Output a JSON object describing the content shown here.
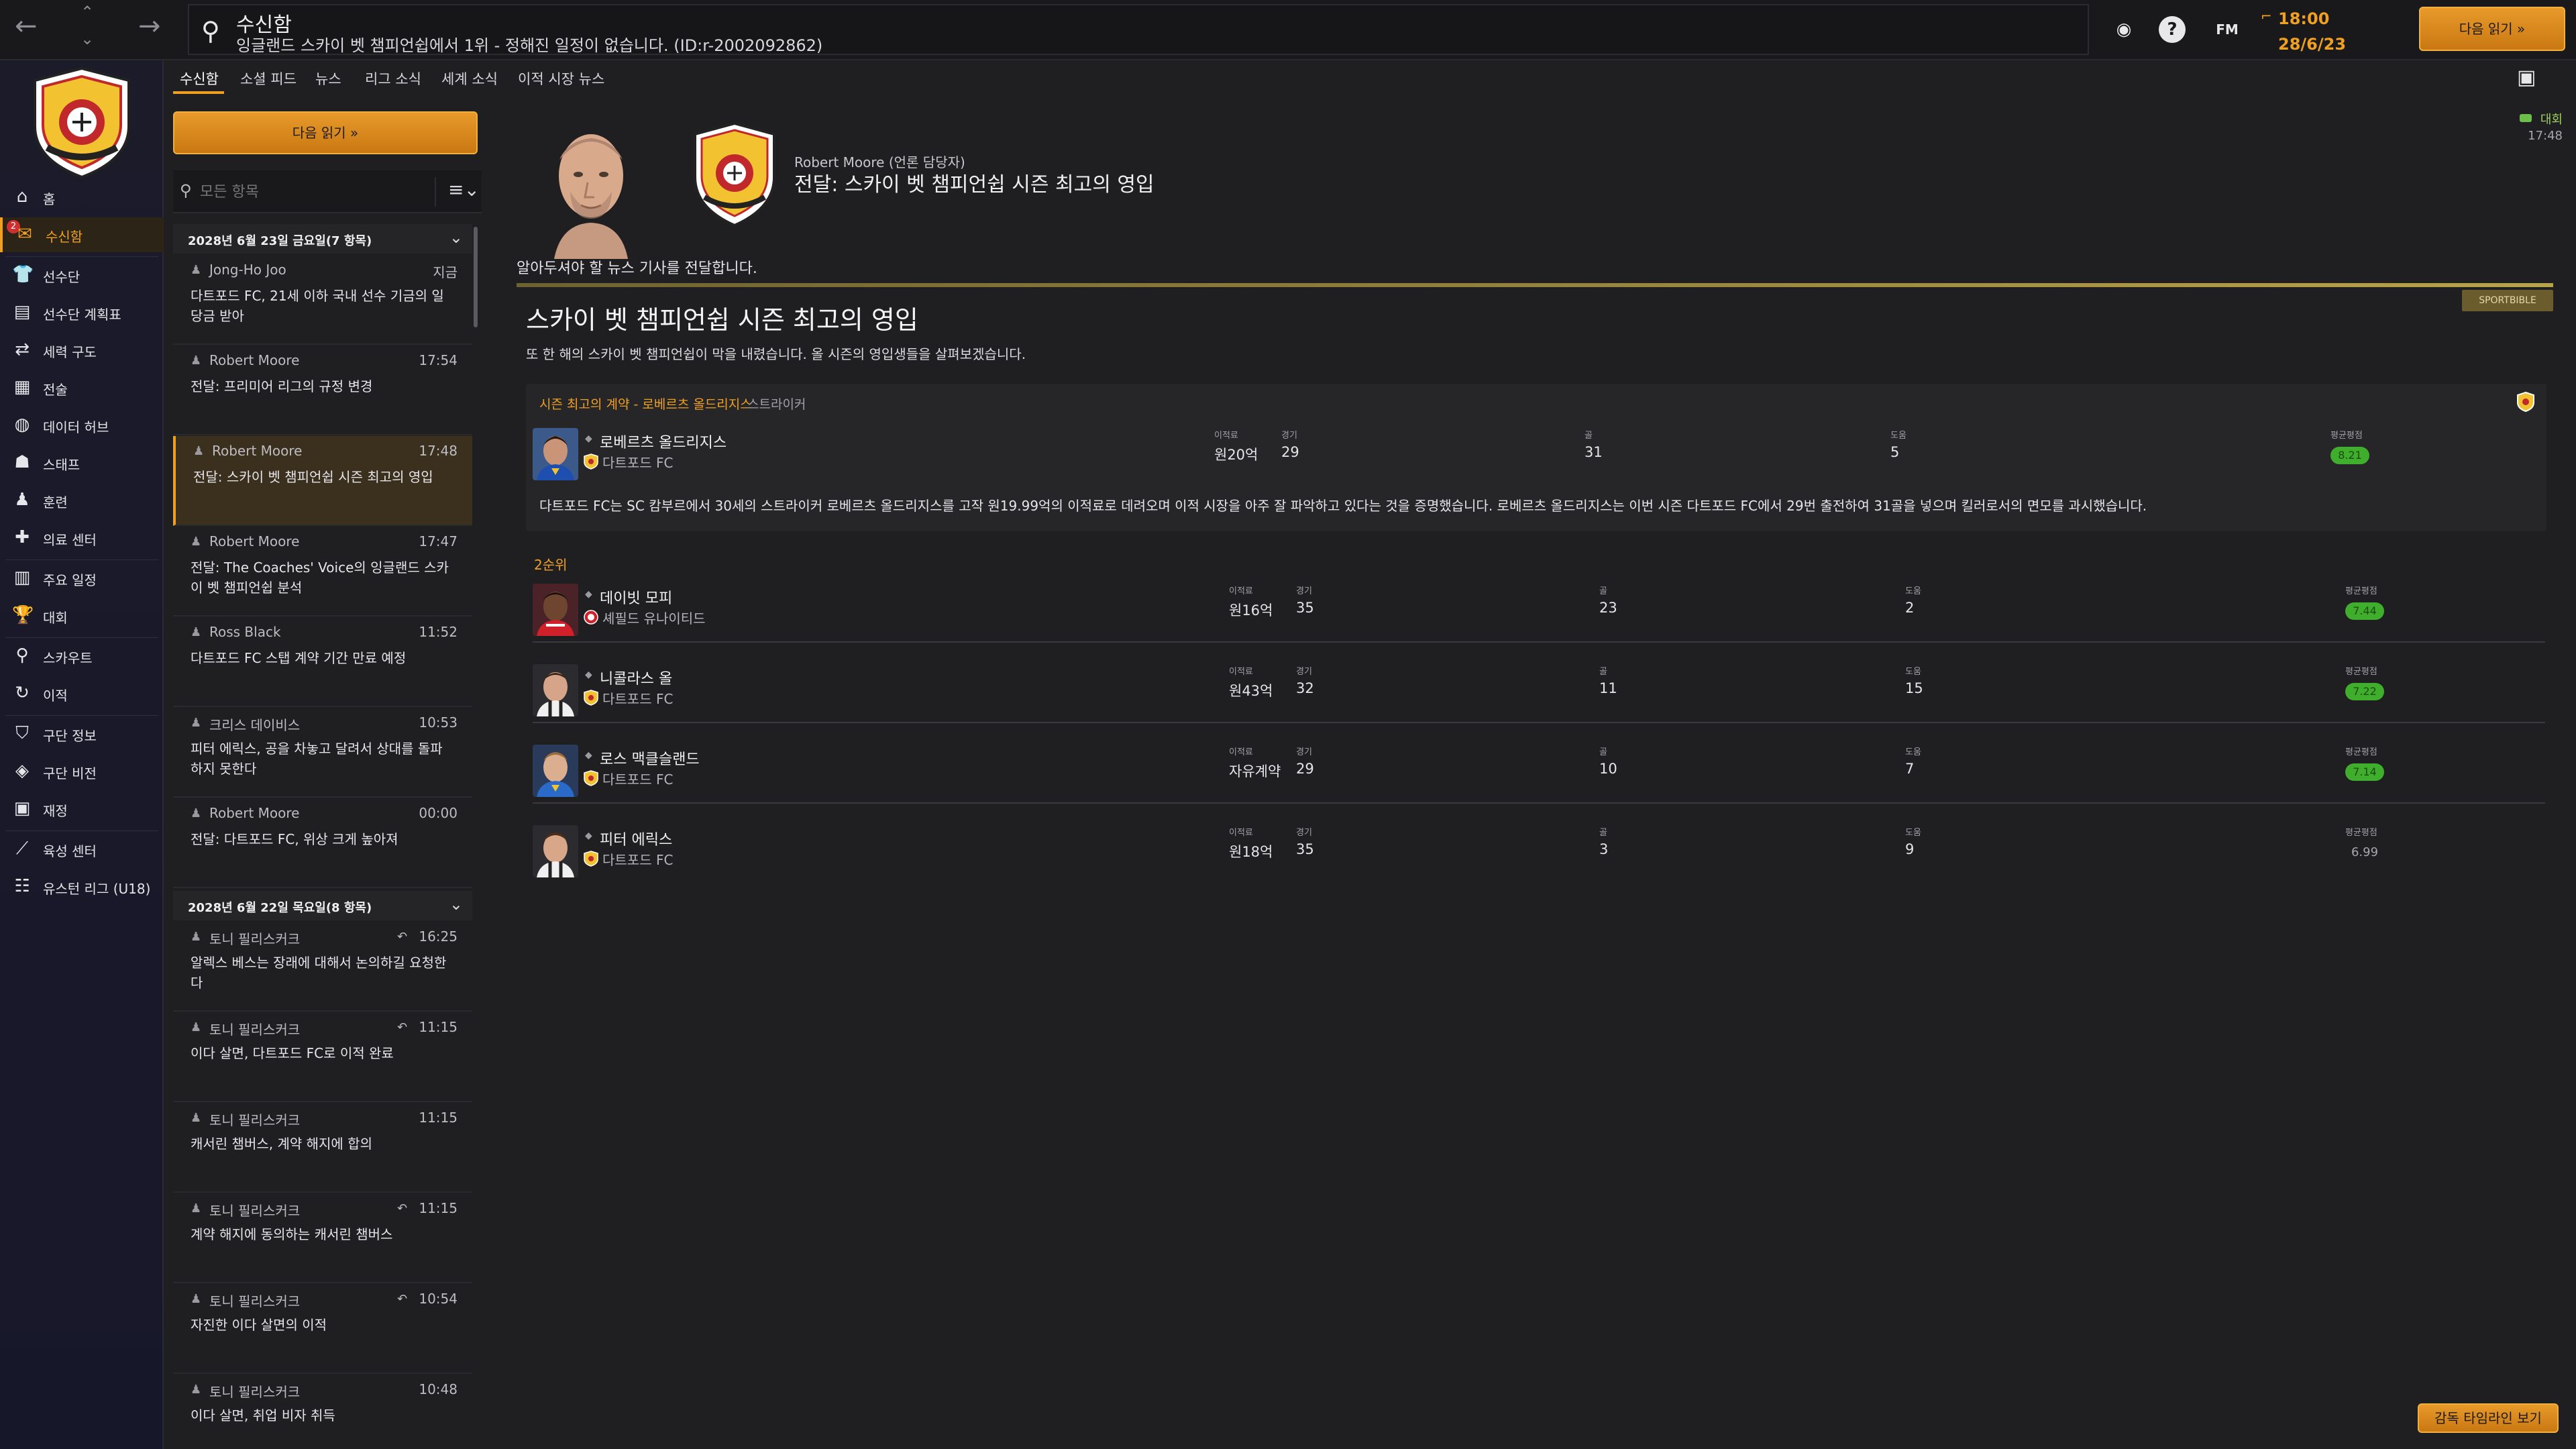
{
  "topbar": {
    "title": "수신함",
    "subtitle": "잉글랜드 스카이 벳 챔피언쉽에서 1위 - 정해진 일정이 없습니다. (ID:r-2002092862)",
    "fm_label": "FM",
    "time": "18:00",
    "date": "28/6/23",
    "continue_label": "다음 읽기 »"
  },
  "sidebar": {
    "items": [
      {
        "label": "홈",
        "icon": "home-icon"
      },
      {
        "label": "수신함",
        "icon": "inbox-icon",
        "badge": "2"
      },
      {
        "label": "선수단",
        "icon": "shirt-icon"
      },
      {
        "label": "선수단 계획표",
        "icon": "clipboard-icon"
      },
      {
        "label": "세력 구도",
        "icon": "dynamics-icon"
      },
      {
        "label": "전술",
        "icon": "tactics-icon"
      },
      {
        "label": "데이터 허브",
        "icon": "data-icon"
      },
      {
        "label": "스태프",
        "icon": "staff-icon"
      },
      {
        "label": "훈련",
        "icon": "training-icon"
      },
      {
        "label": "의료 센터",
        "icon": "medical-icon"
      },
      {
        "label": "주요 일정",
        "icon": "calendar-icon"
      },
      {
        "label": "대회",
        "icon": "trophy-icon"
      },
      {
        "label": "스카우트",
        "icon": "scout-icon"
      },
      {
        "label": "이적",
        "icon": "transfer-icon"
      },
      {
        "label": "구단 정보",
        "icon": "shield-icon"
      },
      {
        "label": "구단 비전",
        "icon": "vision-icon"
      },
      {
        "label": "재정",
        "icon": "finance-icon"
      },
      {
        "label": "육성 센터",
        "icon": "development-icon"
      },
      {
        "label": "유스턴 리그 (U18)",
        "icon": "youth-icon"
      }
    ]
  },
  "tabs": [
    "수신함",
    "소셜 피드",
    "뉴스",
    "리그 소식",
    "세계 소식",
    "이적 시장 뉴스"
  ],
  "inbox": {
    "continue_label": "다음 읽기 »",
    "search_placeholder": "모든 항목",
    "groups": [
      {
        "title": "2028년 6월 23일 금요일(7 항목)",
        "messages": [
          {
            "sender": "Jong-Ho Joo",
            "time": "지금",
            "subject": "다트포드 FC, 21세 이하 국내 선수 기금의 일당금 받아"
          },
          {
            "sender": "Robert Moore",
            "time": "17:54",
            "subject": "전달: 프리미어 리그의 규정 변경"
          },
          {
            "sender": "Robert Moore",
            "time": "17:48",
            "subject": "전달: 스카이 벳 챔피언쉽 시즌 최고의 영입",
            "selected": true
          },
          {
            "sender": "Robert Moore",
            "time": "17:47",
            "subject": "전달: The Coaches' Voice의 잉글랜드 스카이 벳 챔피언쉽 분석"
          },
          {
            "sender": "Ross Black",
            "time": "11:52",
            "subject": "다트포드 FC 스탭 계약 기간 만료 예정"
          },
          {
            "sender": "크리스 데이비스",
            "time": "10:53",
            "subject": "피터 에릭스, 공을 차놓고 달려서 상대를 돌파하지 못한다"
          },
          {
            "sender": "Robert Moore",
            "time": "00:00",
            "subject": "전달: 다트포드 FC, 위상 크게 높아져"
          }
        ]
      },
      {
        "title": "2028년 6월 22일 목요일(8 항목)",
        "messages": [
          {
            "sender": "토니 필리스커크",
            "time": "16:25",
            "subject": "알렉스 베스는 장래에 대해서 논의하길 요청한다",
            "reply": true
          },
          {
            "sender": "토니 필리스커크",
            "time": "11:15",
            "subject": "이다 살면, 다트포드 FC로 이적 완료",
            "reply": true
          },
          {
            "sender": "토니 필리스커크",
            "time": "11:15",
            "subject": "캐서린 챔버스, 계약 해지에 합의"
          },
          {
            "sender": "토니 필리스커크",
            "time": "11:15",
            "subject": "계약 해지에 동의하는 캐서린 챔버스",
            "reply": true
          },
          {
            "sender": "토니 필리스커크",
            "time": "10:54",
            "subject": "자진한 이다 살면의 이적",
            "reply": true
          },
          {
            "sender": "토니 필리스커크",
            "time": "10:48",
            "subject": "이다 살면, 취업 비자 취득"
          }
        ]
      }
    ]
  },
  "message": {
    "from": "Robert Moore (언론 담당자)",
    "subject": "전달: 스카이 벳 챔피언쉽 시즌 최고의 영입",
    "tag": "대회",
    "time": "17:48",
    "intro": "알아두셔야 할 뉴스 기사를 전달합니다.",
    "sponsor": "SPORTBIBLE",
    "article_title": "스카이 벳 챔피언쉽 시즌 최고의 영입",
    "article_lead": "또 한 해의 스카이 벳 챔피언쉽이 막을 내렸습니다. 올 시즌의 영입생들을 살펴보겠습니다.",
    "best_label": "시즌 최고의 계약 - 로베르츠 올드리지스",
    "best_position": "스트라이커",
    "best_desc": "다트포드 FC는 SC 캄부르에서 30세의 스트라이커 로베르츠 올드리지스를 고작 원19.99억의 이적료로 데려오며 이적 시장을 아주 잘 파악하고 있다는 것을 증명했습니다. 로베르츠 올드리지스는 이번 시즌 다트포드 FC에서 29번 출전하여 31골을 넣으며 킬러로서의 면모를 과시했습니다.",
    "col_headers": {
      "fee": "이적료",
      "apps": "경기",
      "goals": "골",
      "assists": "도움",
      "rating": "평균평점"
    },
    "second_label": "2순위",
    "best_player": {
      "name": "로베르츠 올드리지스",
      "club": "다트포드 FC",
      "fee": "원20억",
      "apps": "29",
      "goals": "31",
      "assists": "5",
      "rating": "8.21"
    },
    "runners_up": [
      {
        "name": "데이빗 모피",
        "club": "셰필드 유나이티드",
        "fee": "원16억",
        "apps": "35",
        "goals": "23",
        "assists": "2",
        "rating": "7.44",
        "rating_color": "green"
      },
      {
        "name": "니콜라스 올",
        "club": "다트포드 FC",
        "fee": "원43억",
        "apps": "32",
        "goals": "11",
        "assists": "15",
        "rating": "7.22",
        "rating_color": "green"
      },
      {
        "name": "로스 맥클슬랜드",
        "club": "다트포드 FC",
        "fee": "자유계약",
        "apps": "29",
        "goals": "10",
        "assists": "7",
        "rating": "7.14",
        "rating_color": "green"
      },
      {
        "name": "피터 에릭스",
        "club": "다트포드 FC",
        "fee": "원18억",
        "apps": "35",
        "goals": "3",
        "assists": "9",
        "rating": "6.99",
        "rating_color": "plain"
      }
    ]
  },
  "footer": {
    "timeline_label": "감독 타임라인 보기"
  },
  "colors": {
    "accent": "#f0a020",
    "rating_green": "#3fae2c",
    "background": "#1f1f22"
  }
}
